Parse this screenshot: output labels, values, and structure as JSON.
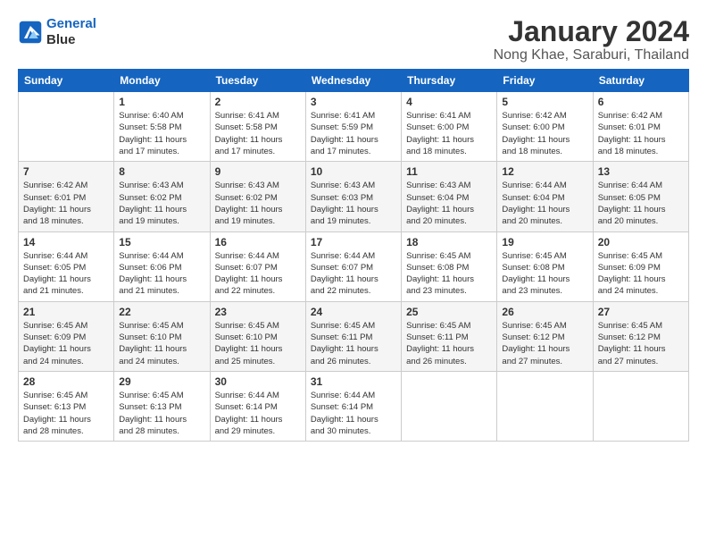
{
  "logo": {
    "line1": "General",
    "line2": "Blue"
  },
  "title": "January 2024",
  "subtitle": "Nong Khae, Saraburi, Thailand",
  "days_of_week": [
    "Sunday",
    "Monday",
    "Tuesday",
    "Wednesday",
    "Thursday",
    "Friday",
    "Saturday"
  ],
  "weeks": [
    [
      {
        "day": "",
        "info": ""
      },
      {
        "day": "1",
        "info": "Sunrise: 6:40 AM\nSunset: 5:58 PM\nDaylight: 11 hours\nand 17 minutes."
      },
      {
        "day": "2",
        "info": "Sunrise: 6:41 AM\nSunset: 5:58 PM\nDaylight: 11 hours\nand 17 minutes."
      },
      {
        "day": "3",
        "info": "Sunrise: 6:41 AM\nSunset: 5:59 PM\nDaylight: 11 hours\nand 17 minutes."
      },
      {
        "day": "4",
        "info": "Sunrise: 6:41 AM\nSunset: 6:00 PM\nDaylight: 11 hours\nand 18 minutes."
      },
      {
        "day": "5",
        "info": "Sunrise: 6:42 AM\nSunset: 6:00 PM\nDaylight: 11 hours\nand 18 minutes."
      },
      {
        "day": "6",
        "info": "Sunrise: 6:42 AM\nSunset: 6:01 PM\nDaylight: 11 hours\nand 18 minutes."
      }
    ],
    [
      {
        "day": "7",
        "info": "Sunrise: 6:42 AM\nSunset: 6:01 PM\nDaylight: 11 hours\nand 18 minutes."
      },
      {
        "day": "8",
        "info": "Sunrise: 6:43 AM\nSunset: 6:02 PM\nDaylight: 11 hours\nand 19 minutes."
      },
      {
        "day": "9",
        "info": "Sunrise: 6:43 AM\nSunset: 6:02 PM\nDaylight: 11 hours\nand 19 minutes."
      },
      {
        "day": "10",
        "info": "Sunrise: 6:43 AM\nSunset: 6:03 PM\nDaylight: 11 hours\nand 19 minutes."
      },
      {
        "day": "11",
        "info": "Sunrise: 6:43 AM\nSunset: 6:04 PM\nDaylight: 11 hours\nand 20 minutes."
      },
      {
        "day": "12",
        "info": "Sunrise: 6:44 AM\nSunset: 6:04 PM\nDaylight: 11 hours\nand 20 minutes."
      },
      {
        "day": "13",
        "info": "Sunrise: 6:44 AM\nSunset: 6:05 PM\nDaylight: 11 hours\nand 20 minutes."
      }
    ],
    [
      {
        "day": "14",
        "info": "Sunrise: 6:44 AM\nSunset: 6:05 PM\nDaylight: 11 hours\nand 21 minutes."
      },
      {
        "day": "15",
        "info": "Sunrise: 6:44 AM\nSunset: 6:06 PM\nDaylight: 11 hours\nand 21 minutes."
      },
      {
        "day": "16",
        "info": "Sunrise: 6:44 AM\nSunset: 6:07 PM\nDaylight: 11 hours\nand 22 minutes."
      },
      {
        "day": "17",
        "info": "Sunrise: 6:44 AM\nSunset: 6:07 PM\nDaylight: 11 hours\nand 22 minutes."
      },
      {
        "day": "18",
        "info": "Sunrise: 6:45 AM\nSunset: 6:08 PM\nDaylight: 11 hours\nand 23 minutes."
      },
      {
        "day": "19",
        "info": "Sunrise: 6:45 AM\nSunset: 6:08 PM\nDaylight: 11 hours\nand 23 minutes."
      },
      {
        "day": "20",
        "info": "Sunrise: 6:45 AM\nSunset: 6:09 PM\nDaylight: 11 hours\nand 24 minutes."
      }
    ],
    [
      {
        "day": "21",
        "info": "Sunrise: 6:45 AM\nSunset: 6:09 PM\nDaylight: 11 hours\nand 24 minutes."
      },
      {
        "day": "22",
        "info": "Sunrise: 6:45 AM\nSunset: 6:10 PM\nDaylight: 11 hours\nand 24 minutes."
      },
      {
        "day": "23",
        "info": "Sunrise: 6:45 AM\nSunset: 6:10 PM\nDaylight: 11 hours\nand 25 minutes."
      },
      {
        "day": "24",
        "info": "Sunrise: 6:45 AM\nSunset: 6:11 PM\nDaylight: 11 hours\nand 26 minutes."
      },
      {
        "day": "25",
        "info": "Sunrise: 6:45 AM\nSunset: 6:11 PM\nDaylight: 11 hours\nand 26 minutes."
      },
      {
        "day": "26",
        "info": "Sunrise: 6:45 AM\nSunset: 6:12 PM\nDaylight: 11 hours\nand 27 minutes."
      },
      {
        "day": "27",
        "info": "Sunrise: 6:45 AM\nSunset: 6:12 PM\nDaylight: 11 hours\nand 27 minutes."
      }
    ],
    [
      {
        "day": "28",
        "info": "Sunrise: 6:45 AM\nSunset: 6:13 PM\nDaylight: 11 hours\nand 28 minutes."
      },
      {
        "day": "29",
        "info": "Sunrise: 6:45 AM\nSunset: 6:13 PM\nDaylight: 11 hours\nand 28 minutes."
      },
      {
        "day": "30",
        "info": "Sunrise: 6:44 AM\nSunset: 6:14 PM\nDaylight: 11 hours\nand 29 minutes."
      },
      {
        "day": "31",
        "info": "Sunrise: 6:44 AM\nSunset: 6:14 PM\nDaylight: 11 hours\nand 30 minutes."
      },
      {
        "day": "",
        "info": ""
      },
      {
        "day": "",
        "info": ""
      },
      {
        "day": "",
        "info": ""
      }
    ]
  ]
}
